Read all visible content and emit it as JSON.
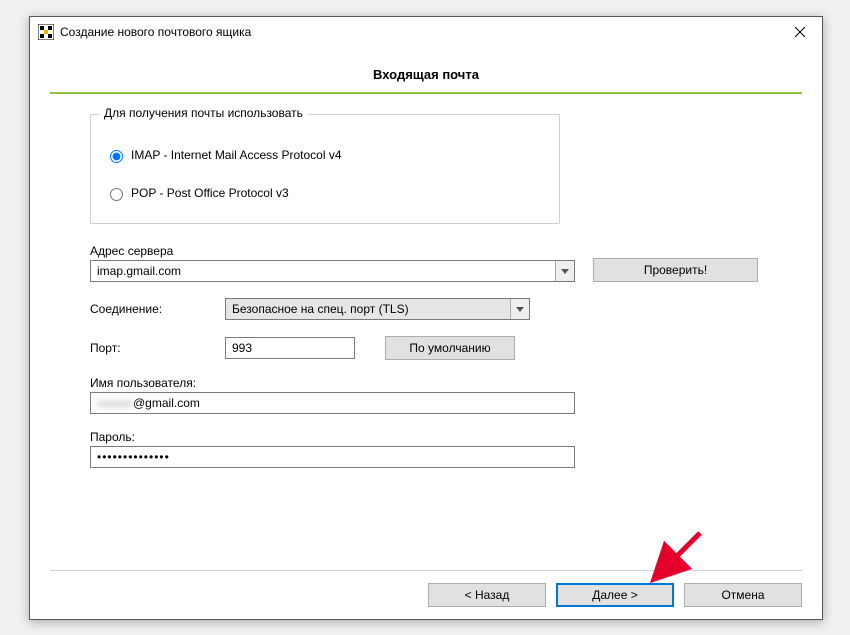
{
  "window": {
    "title": "Создание нового почтового ящика"
  },
  "page": {
    "title": "Входящая почта"
  },
  "protocol": {
    "group_label": "Для получения почты использовать",
    "imap_label": "IMAP - Internet Mail Access Protocol v4",
    "pop_label": "POP  -  Post Office Protocol v3",
    "selected": "imap"
  },
  "server": {
    "label": "Адрес сервера",
    "value": "imap.gmail.com",
    "check_button": "Проверить!"
  },
  "connection": {
    "label": "Соединение:",
    "value": "Безопасное на спец. порт (TLS)"
  },
  "port": {
    "label": "Порт:",
    "value": "993",
    "default_button": "По умолчанию"
  },
  "username": {
    "label": "Имя пользователя:",
    "value_visible": "@gmail.com",
    "value_hidden_prefix": "xxxxxx"
  },
  "password": {
    "label": "Пароль:",
    "value_mask": "••••••••••••••"
  },
  "buttons": {
    "back": "<  Назад",
    "next": "Далее  >",
    "cancel": "Отмена"
  }
}
